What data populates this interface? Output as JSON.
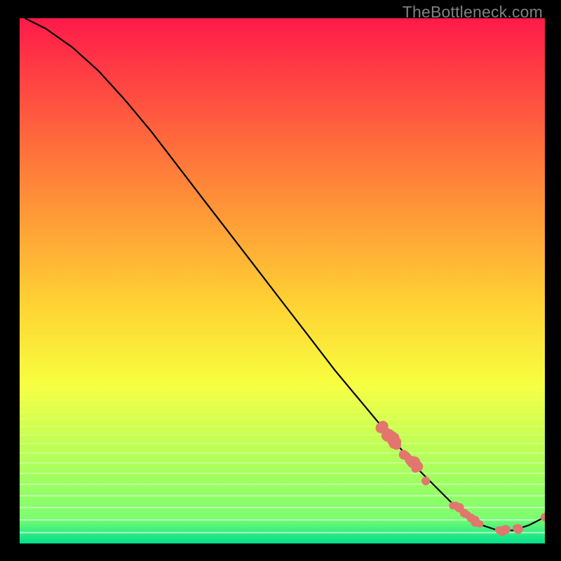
{
  "watermark": "TheBottleneck.com",
  "chart_data": {
    "type": "line",
    "title": "",
    "xlabel": "",
    "ylabel": "",
    "xlim": [
      0,
      100
    ],
    "ylim": [
      0,
      100
    ],
    "series": [
      {
        "name": "curve",
        "x": [
          1,
          5,
          10,
          15,
          20,
          25,
          30,
          35,
          40,
          45,
          50,
          55,
          60,
          65,
          70,
          73,
          76,
          79,
          82,
          85,
          88,
          91,
          94,
          97,
          100
        ],
        "y": [
          100,
          98,
          94.5,
          90,
          84.5,
          78.5,
          72,
          65.5,
          59,
          52.5,
          46,
          39.5,
          33,
          27,
          21,
          17.5,
          14,
          11,
          8,
          5.5,
          3.5,
          2.5,
          2.5,
          3.5,
          5.0
        ]
      }
    ],
    "highlight_band": {
      "y_top": 30,
      "y_bottom": 2.2
    },
    "dots": {
      "cluster1": {
        "comment": "dense diagonal cluster",
        "x_range": [
          68.5,
          77.5
        ],
        "y_range": [
          12,
          23
        ],
        "count": 30
      },
      "cluster2": {
        "comment": "bottom valley cluster",
        "x_range": [
          82,
          95
        ],
        "y_range": [
          2.2,
          3.5
        ],
        "count": 22
      },
      "endpoint": {
        "x": 100,
        "y": 5.0
      }
    },
    "gradient": {
      "top": "#ff1a49",
      "mid1": "#ff7a3a",
      "mid2": "#ffd433",
      "mid3": "#f7ff40",
      "low": "#7dff6e",
      "bottom": "#00e08c"
    },
    "dot_color": "#e2766f",
    "line_color": "#000000"
  }
}
